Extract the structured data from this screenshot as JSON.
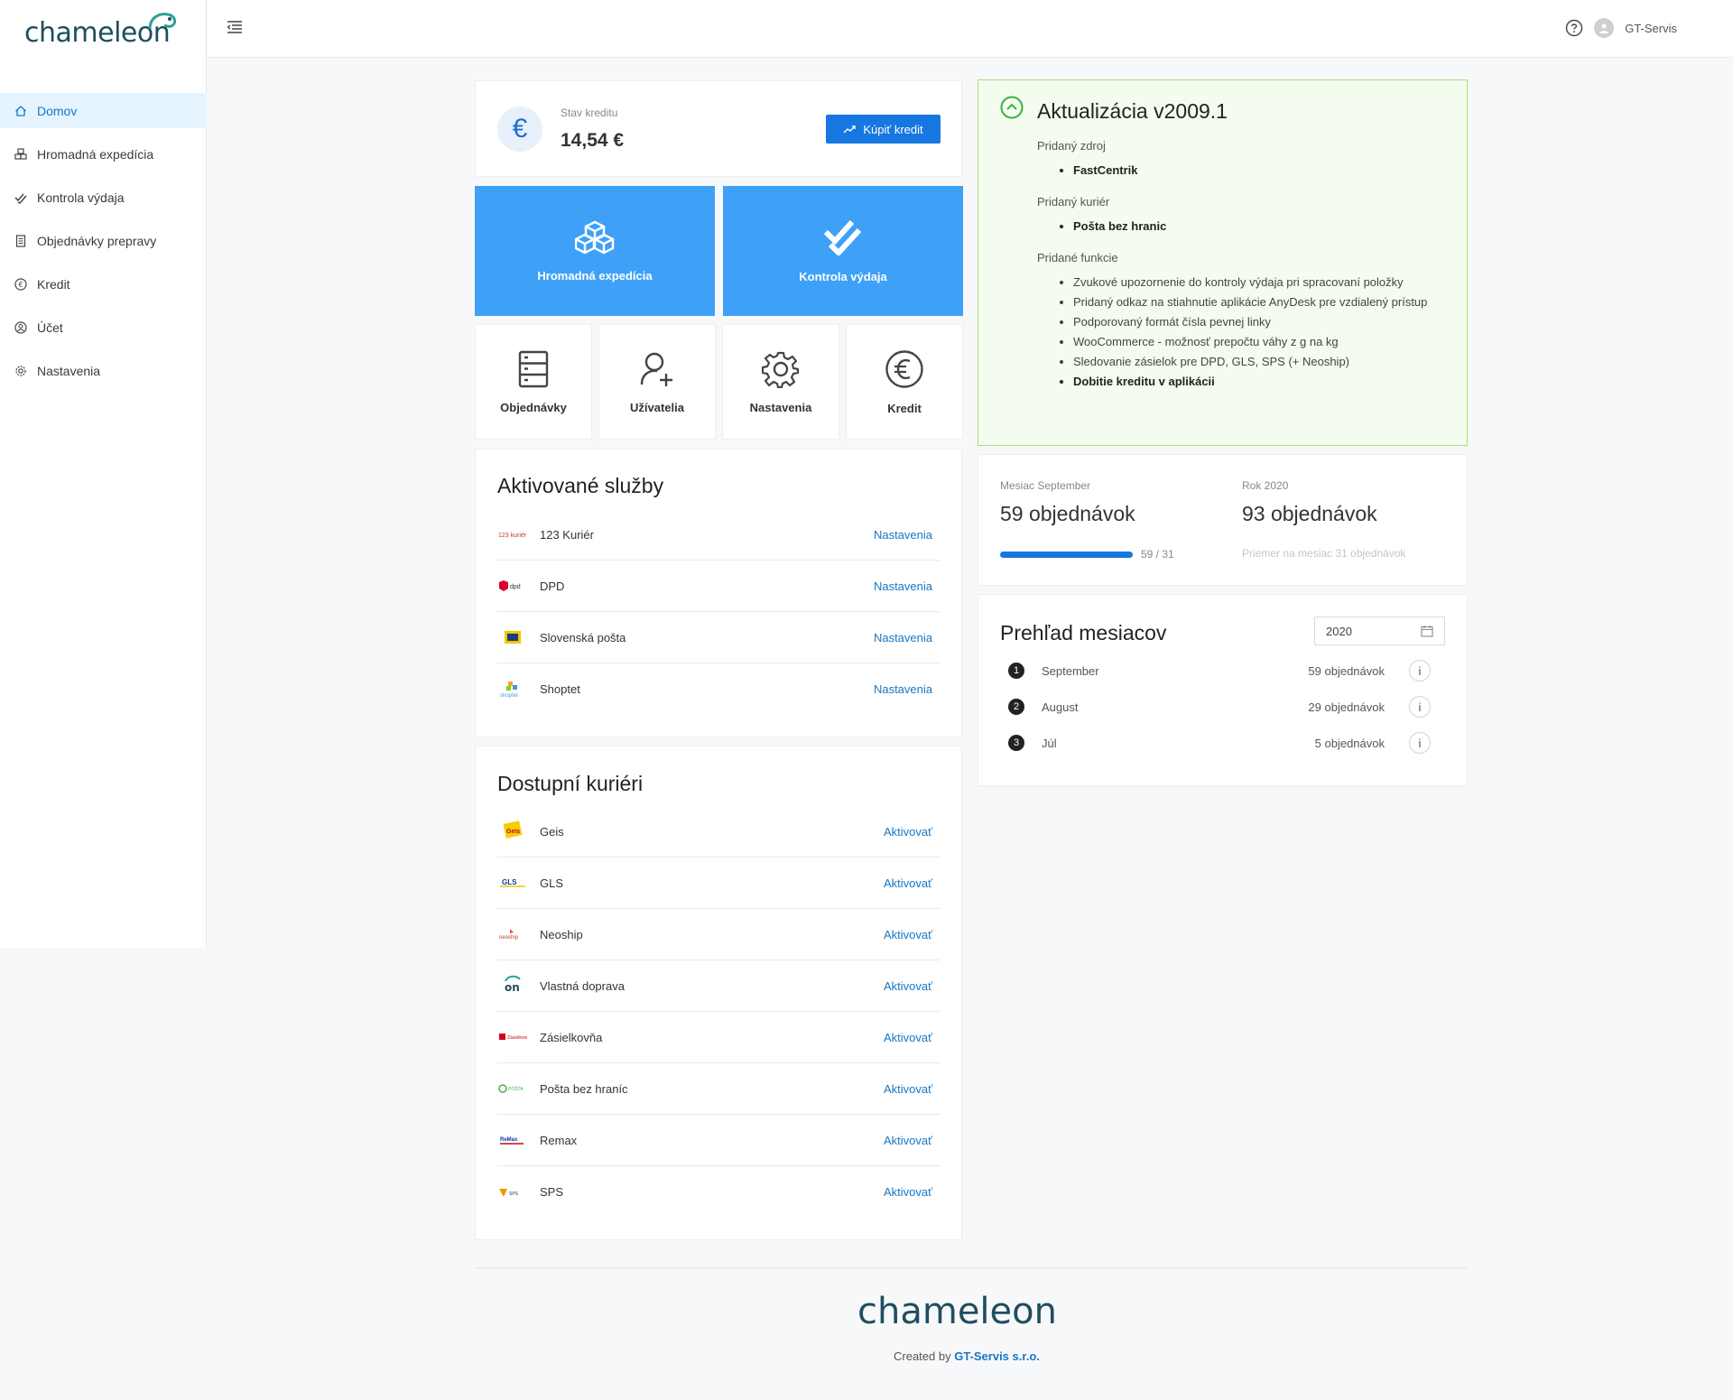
{
  "app": {
    "logo_text": "chameleon"
  },
  "sidebar": {
    "items": [
      {
        "label": "Domov",
        "icon": "home-icon",
        "active": true
      },
      {
        "label": "Hromadná expedícia",
        "icon": "boxes-icon"
      },
      {
        "label": "Kontrola výdaja",
        "icon": "double-check-icon"
      },
      {
        "label": "Objednávky prepravy",
        "icon": "document-icon"
      },
      {
        "label": "Kredit",
        "icon": "euro-icon"
      },
      {
        "label": "Účet",
        "icon": "user-icon"
      },
      {
        "label": "Nastavenia",
        "icon": "gear-icon"
      }
    ]
  },
  "header": {
    "user_name": "GT-Servis"
  },
  "credit": {
    "label": "Stav kreditu",
    "value": "14,54 €",
    "buy_label": "Kúpiť kredit",
    "currency_symbol": "€"
  },
  "tiles": {
    "big": [
      {
        "label": "Hromadná expedícia",
        "icon": "boxes-icon"
      },
      {
        "label": "Kontrola výdaja",
        "icon": "double-check-icon"
      }
    ],
    "small": [
      {
        "label": "Objednávky",
        "icon": "server-icon"
      },
      {
        "label": "Užívatelia",
        "icon": "user-add-icon"
      },
      {
        "label": "Nastavenia",
        "icon": "gear-icon"
      },
      {
        "label": "Kredit",
        "icon": "euro-icon"
      }
    ]
  },
  "services": {
    "title": "Aktivované služby",
    "items": [
      {
        "name": "123 Kuriér",
        "action": "Nastavenia"
      },
      {
        "name": "DPD",
        "action": "Nastavenia"
      },
      {
        "name": "Slovenská pošta",
        "action": "Nastavenia"
      },
      {
        "name": "Shoptet",
        "action": "Nastavenia"
      }
    ]
  },
  "couriers": {
    "title": "Dostupní kuriéri",
    "items": [
      {
        "name": "Geis",
        "action": "Aktivovať"
      },
      {
        "name": "GLS",
        "action": "Aktivovať"
      },
      {
        "name": "Neoship",
        "action": "Aktivovať"
      },
      {
        "name": "Vlastná doprava",
        "action": "Aktivovať"
      },
      {
        "name": "Zásielkovňa",
        "action": "Aktivovať"
      },
      {
        "name": "Pošta bez hraníc",
        "action": "Aktivovať"
      },
      {
        "name": "Remax",
        "action": "Aktivovať"
      },
      {
        "name": "SPS",
        "action": "Aktivovať"
      }
    ]
  },
  "update": {
    "title": "Aktualizácia v2009.1",
    "groups": [
      {
        "heading": "Pridaný zdroj",
        "items": [
          {
            "text": "FastCentrik",
            "bold": true
          }
        ]
      },
      {
        "heading": "Pridaný kuriér",
        "items": [
          {
            "text": "Pošta bez hranic",
            "bold": true
          }
        ]
      },
      {
        "heading": "Pridané funkcie",
        "items": [
          {
            "text": "Zvukové upozornenie do kontroly výdaja pri spracovaní položky",
            "bold": false
          },
          {
            "text": "Pridaný odkaz na stiahnutie aplikácie AnyDesk pre vzdialený prístup",
            "bold": false
          },
          {
            "text": "Podporovaný formát čísla pevnej linky",
            "bold": false
          },
          {
            "text": "WooCommerce - možnosť prepočtu váhy z g na kg",
            "bold": false
          },
          {
            "text": "Sledovanie zásielok pre DPD, GLS, SPS (+ Neoship)",
            "bold": false
          },
          {
            "text": "Dobitie kreditu v aplikácii",
            "bold": true
          }
        ]
      }
    ]
  },
  "stats": {
    "month_label": "Mesiac September",
    "month_value": "59 objednávok",
    "year_label": "Rok 2020",
    "year_value": "93 objednávok",
    "progress_text": "59 / 31",
    "progress_fraction": 1.0,
    "average_text": "Priemer na mesiac 31 objednávok"
  },
  "months": {
    "title": "Prehľad mesiacov",
    "year": "2020",
    "items": [
      {
        "rank": "1",
        "name": "September",
        "count": "59 objednávok"
      },
      {
        "rank": "2",
        "name": "August",
        "count": "29 objednávok"
      },
      {
        "rank": "3",
        "name": "Júl",
        "count": "5 objednávok"
      }
    ]
  },
  "footer": {
    "logo_text": "chameleon",
    "created_by": "Created by",
    "company": "GT-Servis s.r.o."
  },
  "colors": {
    "primary": "#1677e0",
    "tile_blue": "#3fa0f7",
    "update_bg": "#f3fcee",
    "update_border": "#a9e07a",
    "brand_dark": "#1f4e5f",
    "brand_green": "#2aa198"
  }
}
